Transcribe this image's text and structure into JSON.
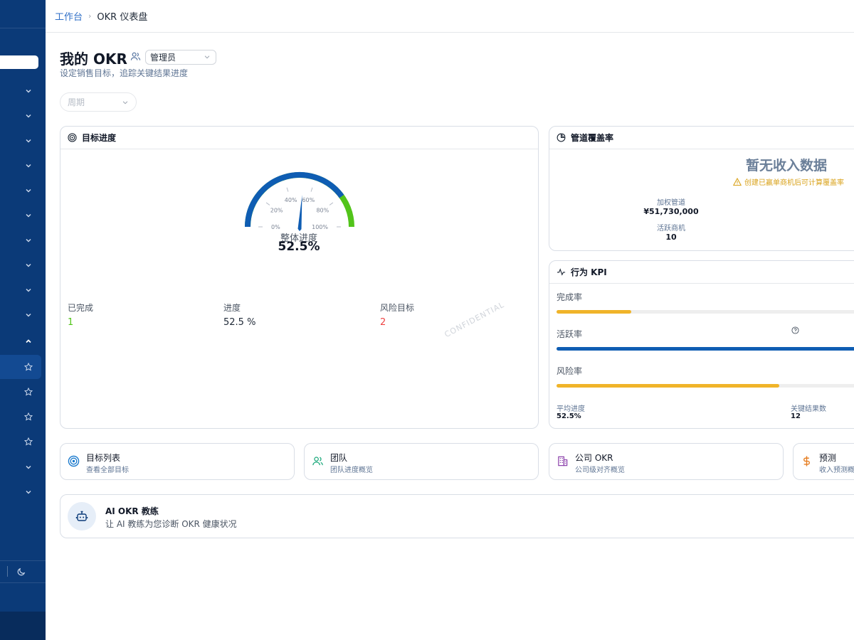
{
  "breadcrumb": {
    "home": "工作台",
    "current": "OKR 仪表盘"
  },
  "header": {
    "title": "我的 OKR",
    "role": "管理员",
    "subtitle": "设定销售目标，追踪关键结果进度",
    "period_placeholder": "周期"
  },
  "progress_card": {
    "title": "目标进度",
    "gauge": {
      "value_percent": 52.5,
      "label": "整体进度",
      "value_text": "52.5%",
      "ticks": [
        "0%",
        "20%",
        "40%",
        "60%",
        "80%",
        "100%"
      ]
    },
    "stats": [
      {
        "label": "已完成",
        "value": "1",
        "color": "#52c41a"
      },
      {
        "label": "进度",
        "value": "52.5 %",
        "color": "#1f2937"
      },
      {
        "label": "风险目标",
        "value": "2",
        "color": "#ef4444"
      }
    ],
    "watermark": "CONFIDENTIAL"
  },
  "pipeline_card": {
    "title": "管道覆盖率",
    "empty_title": "暂无收入数据",
    "warning": "创建已赢单商机后可计算覆盖率",
    "weighted_label": "加权管道",
    "weighted_value": "¥51,730,000",
    "active_label": "活跃商机",
    "active_value": "10"
  },
  "kpi_card": {
    "title": "行为 KPI",
    "bars": [
      {
        "label": "完成率",
        "value_fraction": 0.245,
        "color": "#f0b429"
      },
      {
        "label": "活跃率",
        "value_fraction": 1.0,
        "color": "#0f5db3"
      },
      {
        "label": "风险率",
        "value_fraction": 0.727,
        "color": "#f0b429"
      }
    ],
    "avg_label": "平均进度",
    "avg_value": "52.5%",
    "kr_label": "关键结果数",
    "kr_value": "12"
  },
  "nav_cards": [
    {
      "title": "目标列表",
      "sub": "查看全部目标",
      "icon": "target-icon",
      "color": "#1677cc"
    },
    {
      "title": "团队",
      "sub": "团队进度概览",
      "icon": "team-icon",
      "color": "#1aa87a"
    },
    {
      "title": "公司 OKR",
      "sub": "公司级对齐概览",
      "icon": "building-icon",
      "color": "#8e44ad"
    },
    {
      "title": "预测",
      "sub": "收入预测概",
      "icon": "dollar-icon",
      "color": "#e67e22"
    }
  ],
  "coach": {
    "title": "AI OKR 教练",
    "sub": "让 AI 教练为您诊断 OKR 健康状况"
  }
}
